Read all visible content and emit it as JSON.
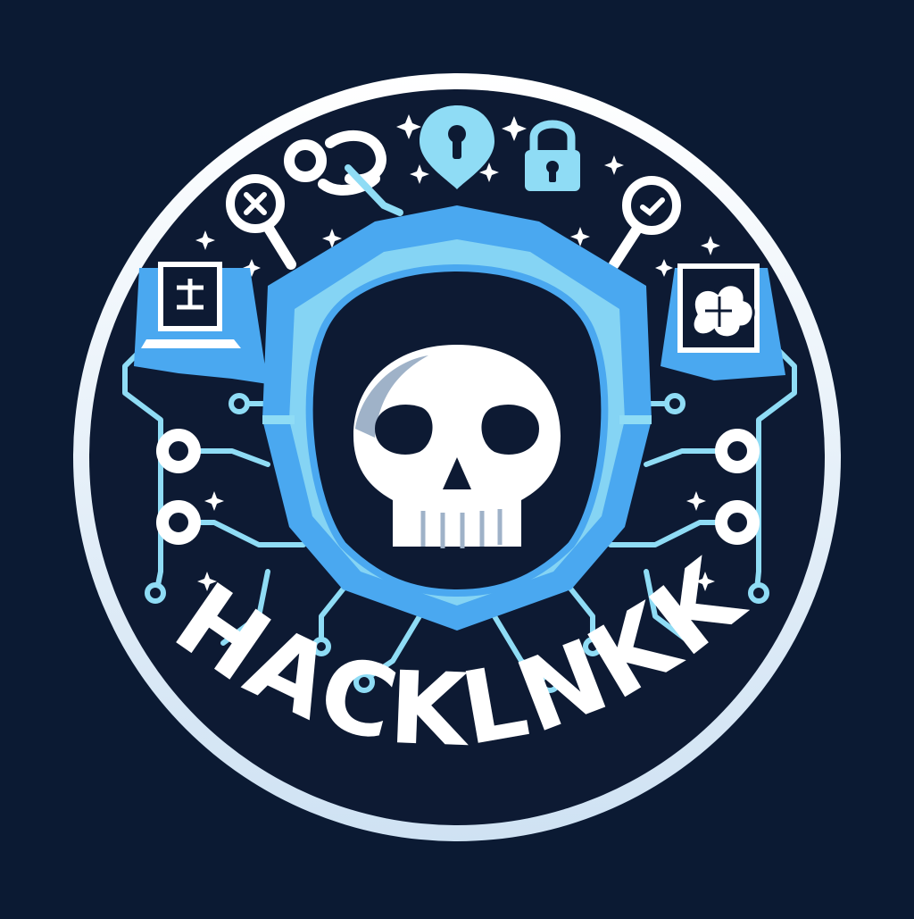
{
  "logo": {
    "wordmark": "HACKLNKK",
    "style": "circular emblem"
  },
  "colors": {
    "background": "#0b1a33",
    "ring": "#e8f2fb",
    "accent_blue": "#4aa8f0",
    "light_cyan": "#8fdcf5",
    "dark_navy": "#0d1a33",
    "skull": "#ffffff",
    "skull_shadow": "#9fb2c8"
  },
  "icons": [
    "skull-icon",
    "hood-icon",
    "padlock-icon",
    "keyhole-pin-icon",
    "magnifier-icon",
    "chain-link-icon",
    "laptop-icon",
    "brain-monitor-icon",
    "circuit-node-icon",
    "sparkle-icon"
  ]
}
